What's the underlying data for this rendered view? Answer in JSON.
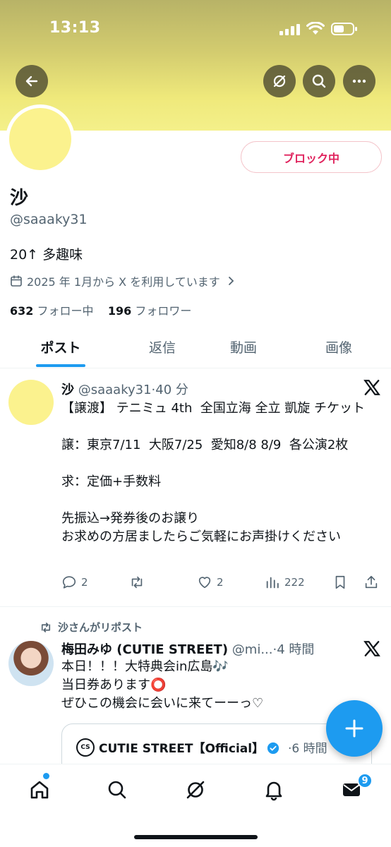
{
  "status_bar": {
    "time": "13:13"
  },
  "profile": {
    "block_button": "ブロック中",
    "name": "沙",
    "handle": "@saaaky31",
    "bio": "20↑ 多趣味",
    "joined": "2025 年 1月から X を利用しています",
    "following_count": "632",
    "following_label": "フォロー中",
    "followers_count": "196",
    "followers_label": "フォロワー"
  },
  "tabs": [
    {
      "label": "ポスト",
      "active": true
    },
    {
      "label": "返信"
    },
    {
      "label": "動画"
    },
    {
      "label": "画像"
    }
  ],
  "posts": [
    {
      "name": "沙",
      "handle": "@saaaky31",
      "time": "40 分",
      "text": "【譲渡】 テニミュ 4th  全国立海 全立 凱旋 チケット\n\n譲：東京7/11  大阪7/25  愛知8/8 8/9  各公演2枚\n\n求：定価+手数料\n\n先振込→発券後のお譲り\nお求めの方居ましたらご気軽にお声掛けください",
      "replies": "2",
      "retweets": "",
      "likes": "2",
      "views": "222"
    },
    {
      "repost_label": "沙さんがリポスト",
      "name": "梅田みゆ (CUTIE STREET)",
      "handle": "@mi...",
      "time": "4 時間",
      "text": "本日！！！大特典会in広島🎶\n当日券あります⭕\nぜひこの機会に会いに来てーーっ♡",
      "quote": {
        "logo_text": "CS",
        "name": "CUTIE STREET【Official】",
        "time": "6 時間"
      }
    }
  ],
  "nav": {
    "messages_badge": "9"
  },
  "colors": {
    "accent": "#1d9bf0",
    "block": "#e0245e",
    "banner": "#efe97b"
  }
}
